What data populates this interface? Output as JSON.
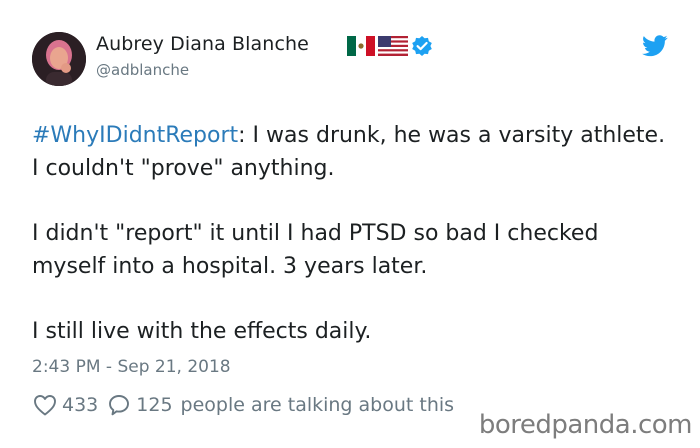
{
  "author": {
    "display_name": "Aubrey Diana Blanche",
    "handle": "@adblanche",
    "flags": [
      "mexico-flag-icon",
      "usa-flag-icon"
    ],
    "verified": true
  },
  "tweet": {
    "hashtag": "#WhyIDidntReport",
    "paragraph_1": ": I was drunk, he was a varsity athlete. I couldn't \"prove\" anything.",
    "paragraph_2": "I didn't \"report\" it until I had PTSD so bad I checked myself into a hospital. 3 years later.",
    "paragraph_3": "I still live with the effects daily.",
    "timestamp": "2:43 PM - Sep 21, 2018"
  },
  "engagement": {
    "likes": "433",
    "replies": "125",
    "talking_text": "people are talking about this"
  },
  "watermark": {
    "text": "boredpanda.com"
  },
  "colors": {
    "link": "#2b7bb9",
    "text": "#1c2022",
    "secondary": "#697882",
    "twitter_blue": "#1da1f2"
  }
}
